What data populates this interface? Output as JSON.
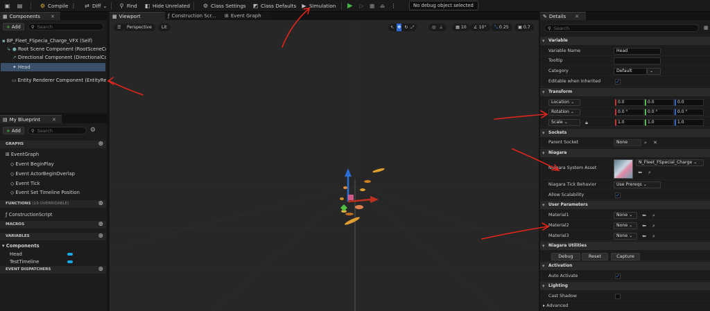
{
  "toolbar": {
    "compile": "Compile",
    "diff": "Diff",
    "find": "Find",
    "hide_unrelated": "Hide Unrelated",
    "class_settings": "Class Settings",
    "class_defaults": "Class Defaults",
    "simulation": "Simulation",
    "debug_select": "No debug object selected"
  },
  "components": {
    "tab": "Components",
    "add": "Add",
    "search_placeholder": "Search",
    "items": [
      "BP_Fleet_FSpecia_Charge_VFX (Self)",
      "Root Scene Component (RootSceneComponent)",
      "Directional Component (DirectionalComponent)",
      "Head",
      "Entity Renderer Component (EntityRenderer)"
    ]
  },
  "myblueprint": {
    "tab": "My Blueprint",
    "add": "Add",
    "search_placeholder": "Search",
    "graphs": "GRAPHS",
    "eventgraph": "EventGraph",
    "events": [
      "Event BeginPlay",
      "Event ActorBeginOverlap",
      "Event Tick",
      "Event Set Timeline Position"
    ],
    "functions": "FUNCTIONS",
    "functions_note": "(19 OVERRIDABLE)",
    "construction": "ConstructionScript",
    "macros": "MACROS",
    "variables": "VARIABLES",
    "var_group": "Components",
    "vars": [
      "Head",
      "TestTimeline"
    ],
    "dispatchers": "EVENT DISPATCHERS"
  },
  "viewport_tabs": [
    "Viewport",
    "Construction Scr...",
    "Event Graph"
  ],
  "viewport": {
    "perspective": "Perspective",
    "lit": "Lit",
    "grid": "10",
    "angle": "10°",
    "scale": "0.25",
    "speed": "0.7"
  },
  "details": {
    "tab": "Details",
    "search_placeholder": "Search",
    "variable": "Variable",
    "variable_name_label": "Variable Name",
    "variable_name": "Head",
    "tooltip": "Tooltip",
    "category": "Category",
    "category_value": "Default",
    "editable": "Editable when Inherited",
    "transform": "Transform",
    "location": "Location",
    "rotation": "Rotation",
    "scale": "Scale",
    "loc": [
      "0.0",
      "0.0",
      "0.0"
    ],
    "rot": [
      "0.0 °",
      "0.0 °",
      "0.0 °"
    ],
    "scl": [
      "1.0",
      "1.0",
      "1.0"
    ],
    "sockets": "Sockets",
    "parent_socket": "Parent Socket",
    "none": "None",
    "niagara": "Niagara",
    "system_asset": "Niagara System Asset",
    "asset_name": "N_Fleet_FSpecial_Charge",
    "tick_behavior": "Niagara Tick Behavior",
    "tick_value": "Use Prereqs",
    "allow_scal": "Allow Scalability",
    "user_params": "User Parameters",
    "materials": [
      "Material1",
      "Material2",
      "Material3"
    ],
    "utilities": "Niagara Utilities",
    "debug": "Debug",
    "reset": "Reset",
    "capture": "Capture",
    "activation": "Activation",
    "auto_activate": "Auto Activate",
    "lighting": "Lighting",
    "cast_shadow": "Cast Shadow",
    "advanced": "Advanced"
  }
}
